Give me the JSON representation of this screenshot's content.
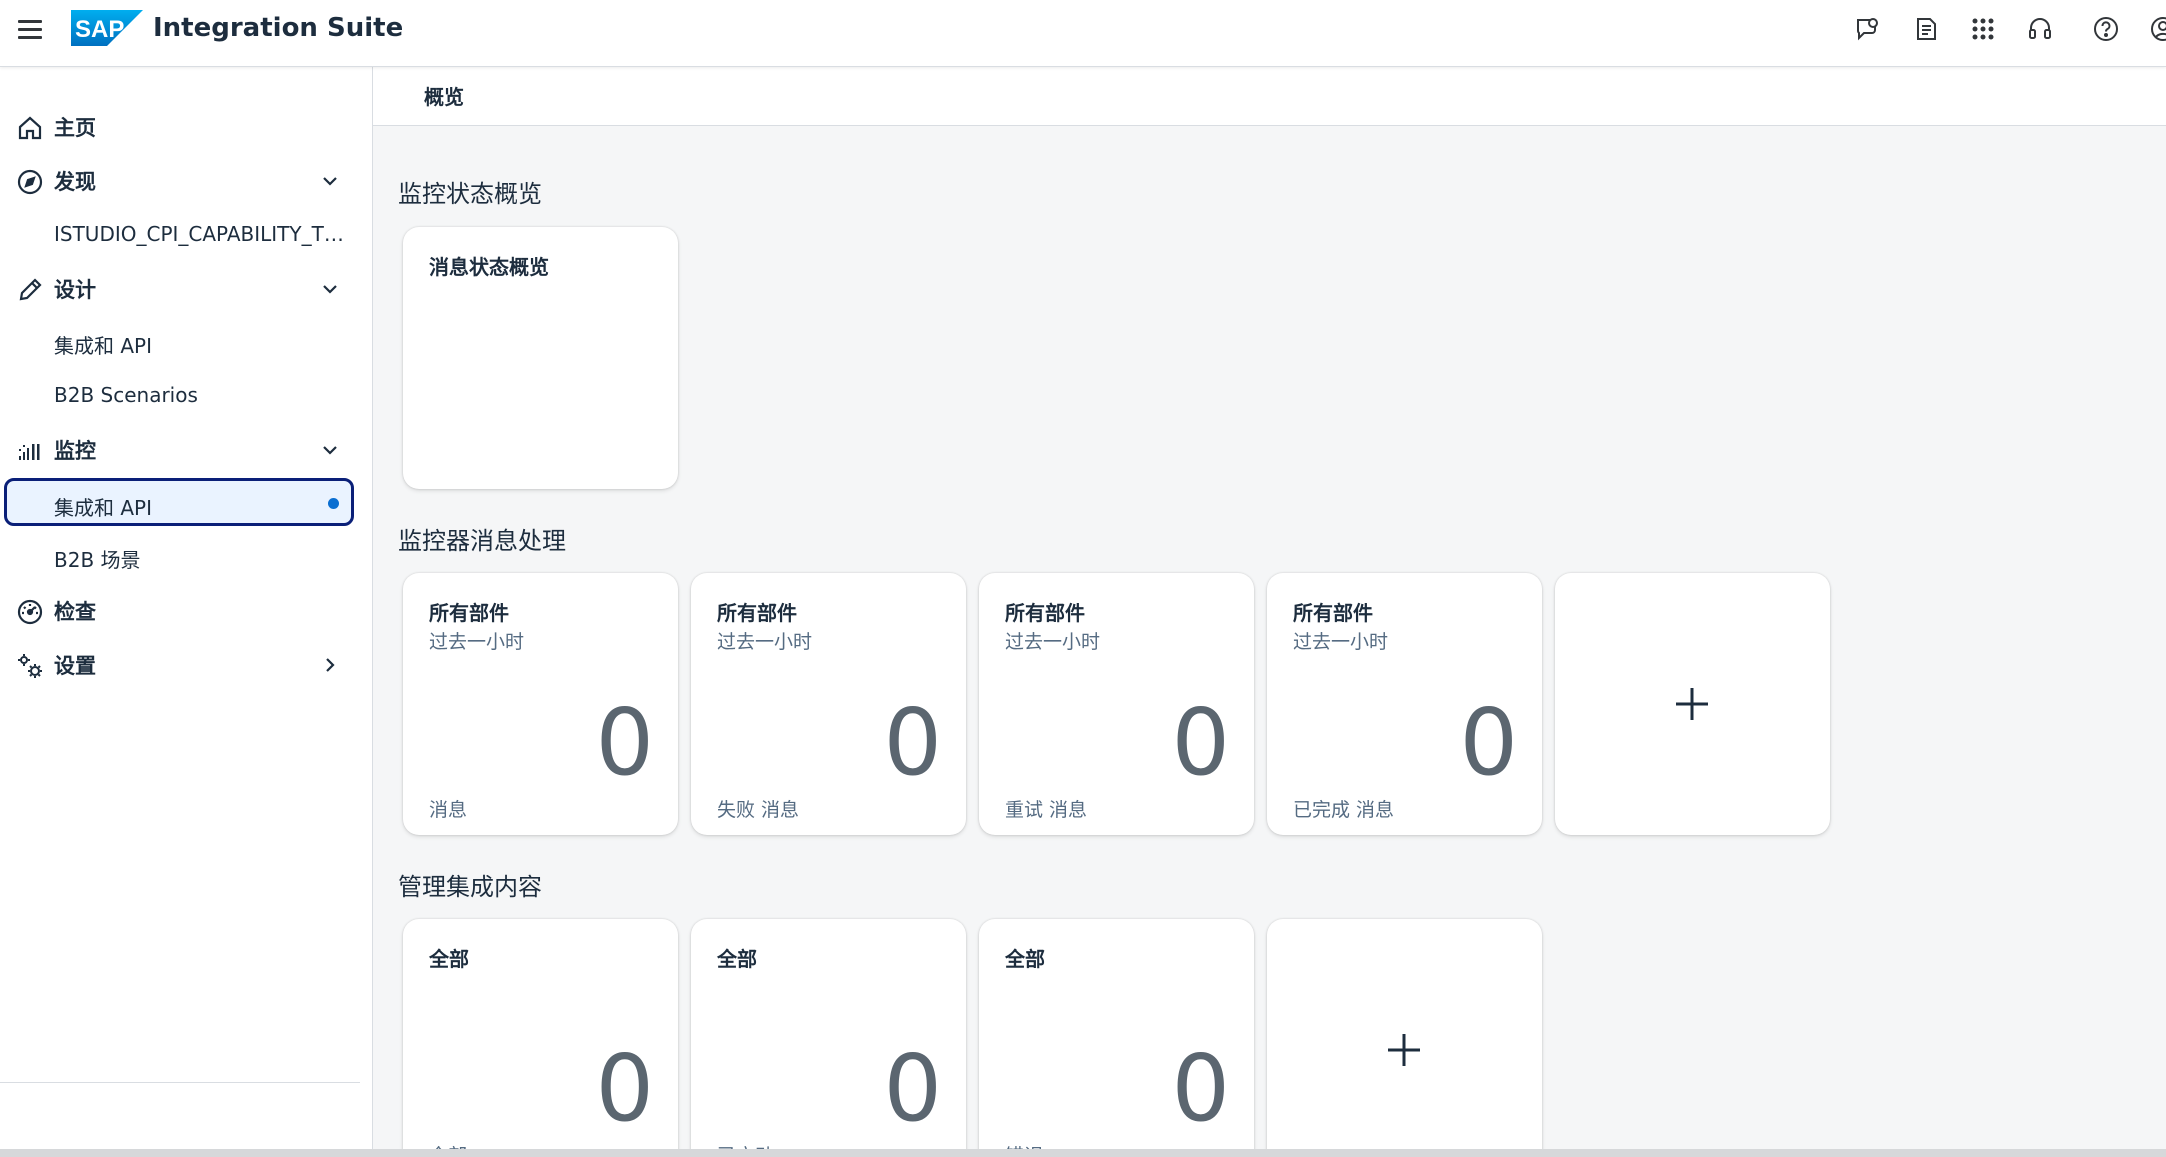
{
  "shell": {
    "logo_text": "SAP",
    "app_title": "Integration Suite",
    "icons": [
      "feedback-icon",
      "notes-icon",
      "app-launcher-icon",
      "headset-icon",
      "help-icon",
      "user-icon"
    ]
  },
  "sidebar": {
    "items": [
      {
        "label": "主页",
        "icon": "home-icon"
      },
      {
        "label": "发现",
        "icon": "compass-icon"
      },
      {
        "label": "ISTUDIO_CPI_CAPABILITY_TEST"
      },
      {
        "label": "设计",
        "icon": "pencil-icon"
      },
      {
        "label": "集成和 API"
      },
      {
        "label": "B2B Scenarios"
      },
      {
        "label": "监控",
        "icon": "monitor-bars-icon"
      },
      {
        "label": "集成和 API"
      },
      {
        "label": "B2B 场景"
      },
      {
        "label": "检查",
        "icon": "inspect-icon"
      },
      {
        "label": "设置",
        "icon": "settings-icon"
      }
    ],
    "selected": "集成和 API",
    "accent": "#0a6ed1"
  },
  "page": {
    "tab": "概览"
  },
  "sections": [
    {
      "title": "监控状态概览",
      "tiles": [
        {
          "title": "消息状态概览"
        }
      ]
    },
    {
      "title": "监控器消息处理",
      "tiles": [
        {
          "title": "所有部件",
          "subtitle": "过去一小时",
          "value": "0",
          "footer": "消息"
        },
        {
          "title": "所有部件",
          "subtitle": "过去一小时",
          "value": "0",
          "footer": "失败 消息"
        },
        {
          "title": "所有部件",
          "subtitle": "过去一小时",
          "value": "0",
          "footer": "重试 消息"
        },
        {
          "title": "所有部件",
          "subtitle": "过去一小时",
          "value": "0",
          "footer": "已完成 消息"
        }
      ]
    },
    {
      "title": "管理集成内容",
      "tiles": [
        {
          "title": "全部",
          "value": "0",
          "footer": "全部"
        },
        {
          "title": "全部",
          "value": "0",
          "footer": "已启动"
        },
        {
          "title": "全部",
          "value": "0",
          "footer": "错误"
        }
      ]
    }
  ]
}
